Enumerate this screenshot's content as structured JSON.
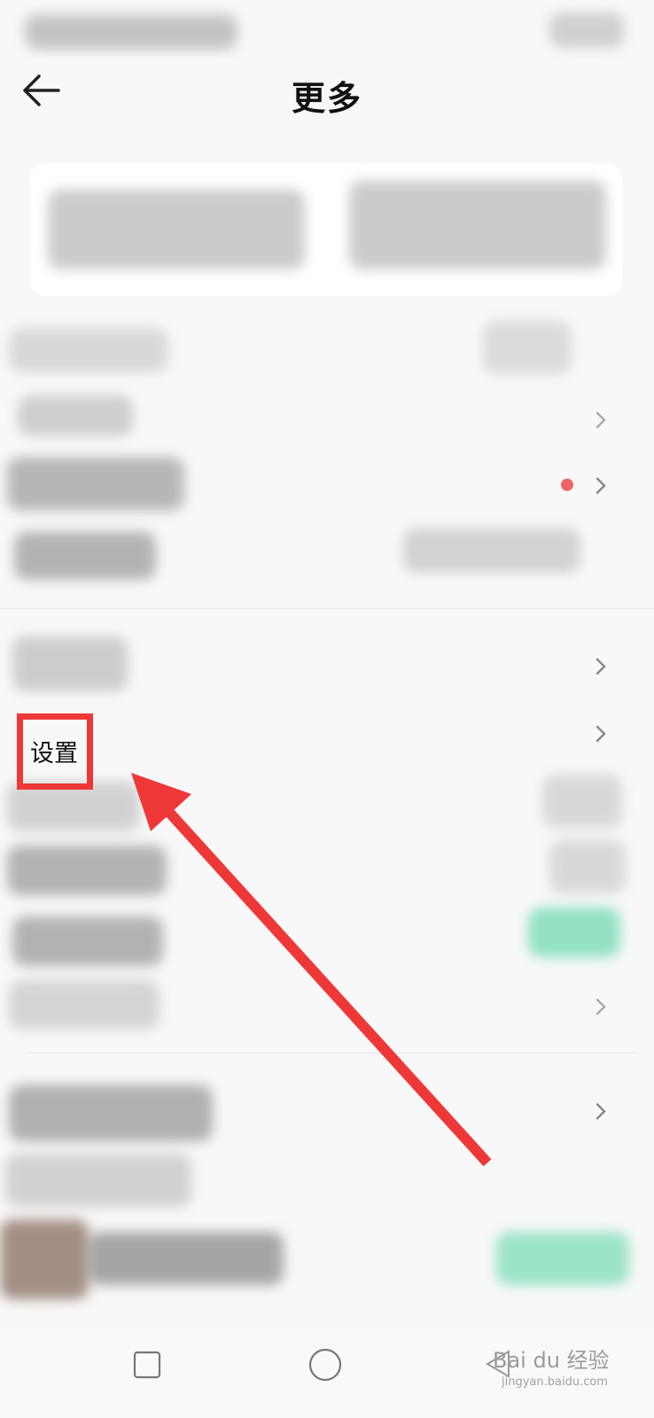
{
  "header": {
    "title": "更多"
  },
  "settings": {
    "label": "设置"
  },
  "watermark": {
    "brand": "Bai du 经验",
    "domain": "jingyan.baidu.com"
  },
  "colors": {
    "background": "#f8f8f8",
    "card": "#ffffff",
    "annotation_red": "#ee3838",
    "badge_dot": "#f06464",
    "accent_green": "#3fcf96"
  },
  "icons": {
    "back": "arrow-left-icon",
    "chevron": "chevron-right-icon",
    "nav_recent": "square-icon",
    "nav_home": "circle-icon"
  }
}
